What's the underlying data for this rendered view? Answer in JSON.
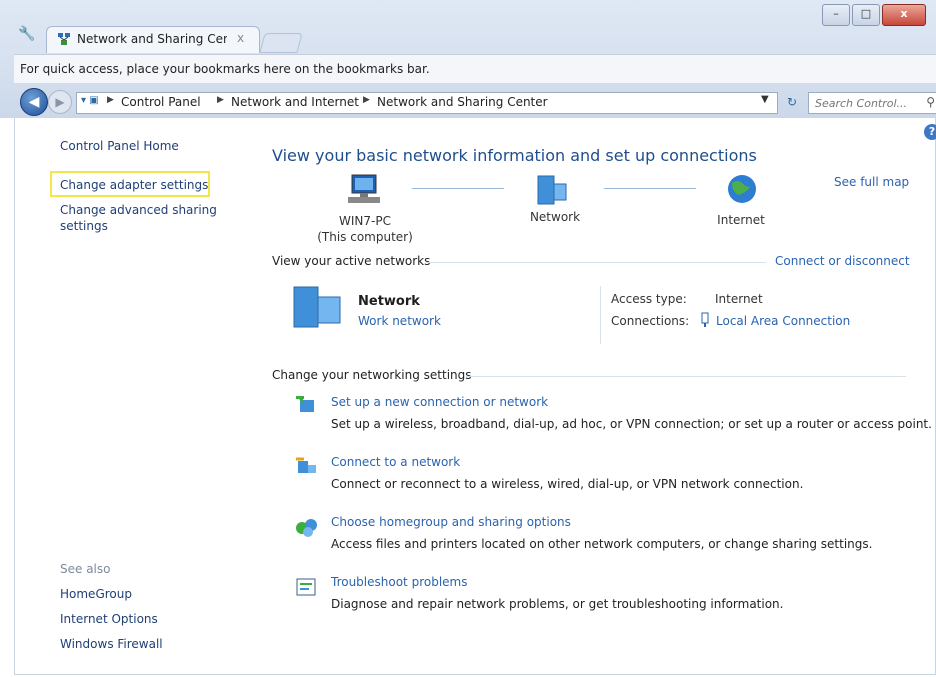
{
  "browser": {
    "tab_title": "Network and Sharing Cent",
    "tab_close": "x",
    "bookmarks_bar_text": "For quick access, place your bookmarks here on the bookmarks bar.",
    "address": {
      "crumbs": [
        "Control Panel",
        "Network and Internet",
        "Network and Sharing Center"
      ],
      "search_placeholder": "Search Control..."
    },
    "window_controls": {
      "minimize": "–",
      "maximize": "□",
      "close": "x"
    }
  },
  "sidebar": {
    "home": "Control Panel Home",
    "links": [
      "Change adapter settings",
      "Change advanced sharing",
      "settings"
    ],
    "see_also_heading": "See also",
    "see_also": [
      "HomeGroup",
      "Internet Options",
      "Windows Firewall"
    ]
  },
  "main": {
    "title": "View your basic network information and set up connections",
    "see_full_map": "See full map",
    "map": {
      "computer_name": "WIN7-PC",
      "computer_sub": "(This computer)",
      "network": "Network",
      "internet": "Internet"
    },
    "active_networks": {
      "heading": "View your active networks",
      "connect_link": "Connect or disconnect",
      "network_name": "Network",
      "network_type": "Work network",
      "access_type_label": "Access type:",
      "access_type_value": "Internet",
      "connections_label": "Connections:",
      "connection_value": "Local Area Connection"
    },
    "settings": {
      "heading": "Change your networking settings",
      "tasks": [
        {
          "link": "Set up a new connection or network",
          "desc": "Set up a wireless, broadband, dial-up, ad hoc, or VPN connection; or set up a router or access point."
        },
        {
          "link": "Connect to a network",
          "desc": "Connect or reconnect to a wireless, wired, dial-up, or VPN network connection."
        },
        {
          "link": "Choose homegroup and sharing options",
          "desc": "Access files and printers located on other network computers, or change sharing settings."
        },
        {
          "link": "Troubleshoot problems",
          "desc": "Diagnose and repair network problems, or get troubleshooting information."
        }
      ]
    }
  },
  "colors": {
    "link": "#2a63b0",
    "title": "#1e4e8c",
    "highlight": "#f5e74a"
  }
}
